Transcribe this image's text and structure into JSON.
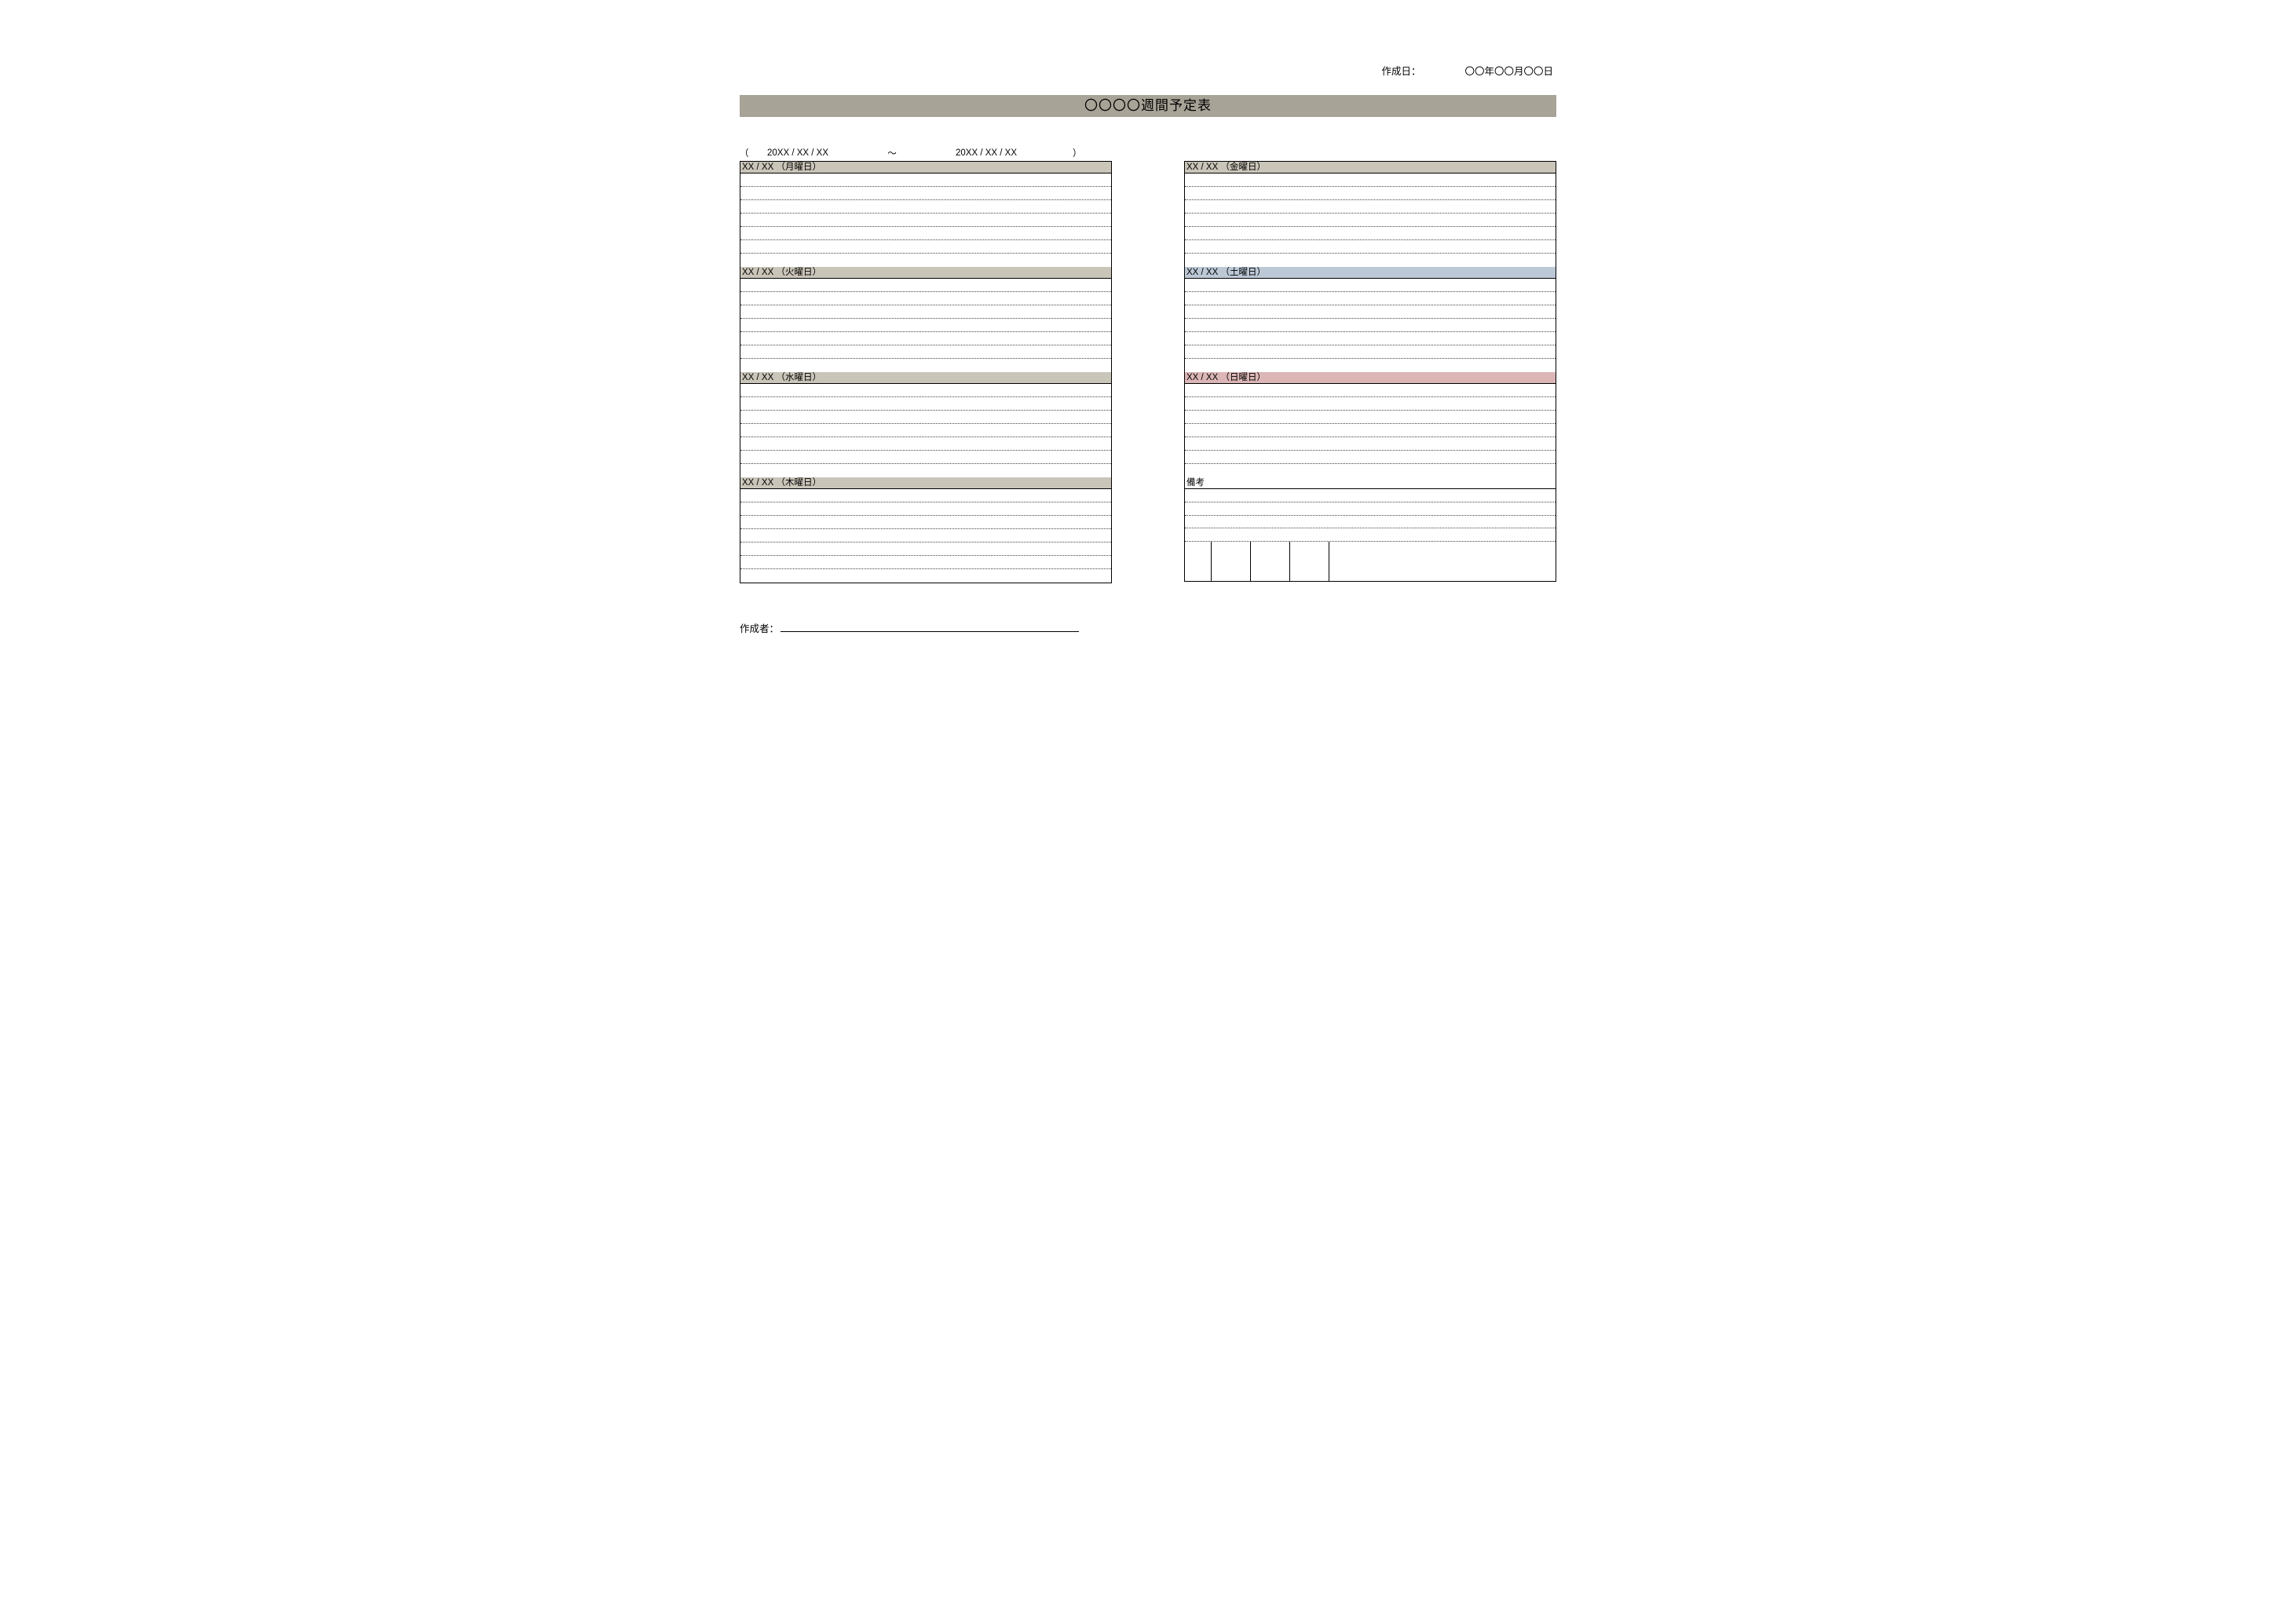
{
  "meta": {
    "created_label": "作成日：",
    "created_date": "〇〇年〇〇月〇〇日"
  },
  "title": "〇〇〇〇週間予定表",
  "range": {
    "open": "（",
    "start": "20XX / XX / XX",
    "tilde": "～",
    "end": "20XX / XX / XX",
    "close": "）"
  },
  "left_days": [
    {
      "label": "XX / XX （月曜日）"
    },
    {
      "label": "XX / XX （火曜日）"
    },
    {
      "label": "XX / XX （水曜日）"
    },
    {
      "label": "XX / XX （木曜日）"
    }
  ],
  "right_days": [
    {
      "label": "XX / XX （金曜日）",
      "cls": "hdr-neutral"
    },
    {
      "label": "XX / XX （土曜日）",
      "cls": "hdr-sat"
    },
    {
      "label": "XX / XX （日曜日）",
      "cls": "hdr-sun"
    }
  ],
  "notes_label": "備考",
  "creator_label": "作成者："
}
